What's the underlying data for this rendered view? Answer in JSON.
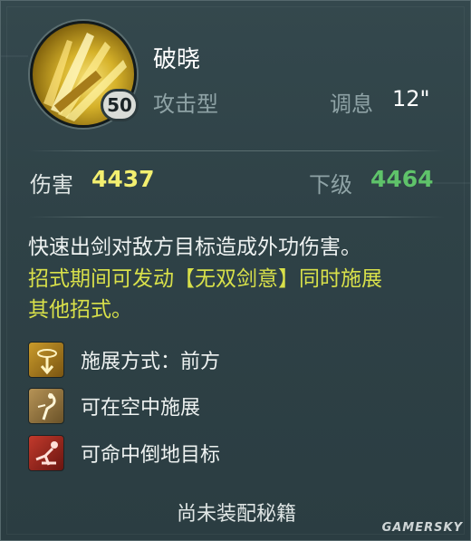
{
  "skill": {
    "name": "破晓",
    "level": "50",
    "type": "攻击型",
    "cooldown_label": "调息",
    "cooldown_value": "12\""
  },
  "stats": {
    "damage_label": "伤害",
    "damage_value": "4437",
    "next_label": "下级",
    "next_value": "4464"
  },
  "description": {
    "line1": "快速出剑对敌方目标造成外功伤害。",
    "line2": "招式期间可发动【无双剑意】同时施展",
    "line3": "其他招式。"
  },
  "traits": [
    {
      "icon": "cast-direction-icon",
      "label": "施展方式：前方"
    },
    {
      "icon": "midair-cast-icon",
      "label": "可在空中施展"
    },
    {
      "icon": "hit-downed-target-icon",
      "label": "可命中倒地目标"
    }
  ],
  "footer": "尚未装配秘籍",
  "watermark": "GAMERSKY",
  "colors": {
    "background": "#2f4247",
    "damage_value": "#f3ef70",
    "next_value": "#5fc36a",
    "highlight_text": "#d8e04a",
    "muted_text": "#8fa3a6"
  }
}
